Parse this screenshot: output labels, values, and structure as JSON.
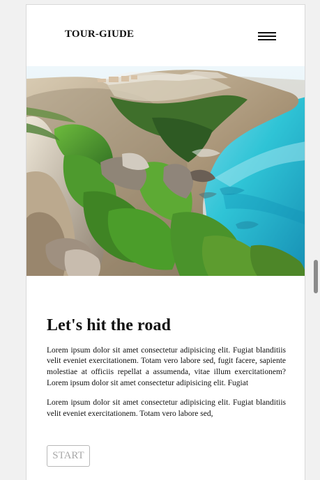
{
  "header": {
    "logo": "TOUR-GIUDE",
    "menu_icon": "hamburger-menu-icon"
  },
  "hero": {
    "image_subject": "coastal cliffs with turquoise sea"
  },
  "main": {
    "headline": "Let's hit the road",
    "paragraphs": [
      "Lorem ipsum dolor sit amet consectetur adipisicing elit. Fugiat blanditiis velit eveniet exercitationem. Totam vero labore sed, fugit facere, sapiente molestiae at officiis repellat a assumenda, vitae illum exercitationem? Lorem ipsum dolor sit amet consectetur adipisicing elit. Fugiat",
      "Lorem ipsum dolor sit amet consectetur adipisicing elit. Fugiat blanditiis velit eveniet exercitationem. Totam vero labore sed,"
    ],
    "start_label": "START"
  },
  "colors": {
    "page_background": "#f1f1f1",
    "card_background": "#ffffff",
    "text": "#111111",
    "button_border": "#b8b8b8",
    "button_text": "#a8a8a8"
  }
}
